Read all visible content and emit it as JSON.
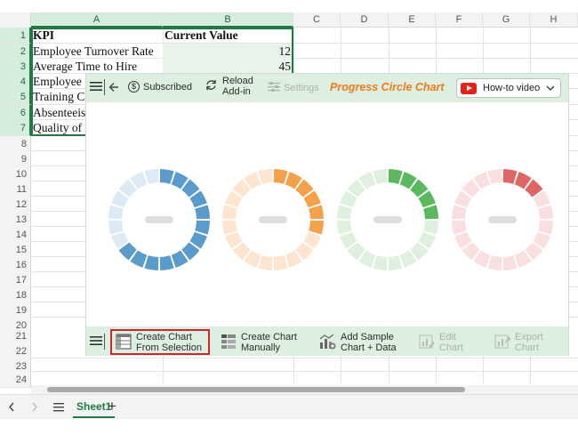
{
  "spreadsheet": {
    "columns": [
      "A",
      "B",
      "C",
      "D",
      "E",
      "F",
      "G",
      "H"
    ],
    "rows": [
      "1",
      "2",
      "3",
      "4",
      "5",
      "6",
      "7",
      "8",
      "9",
      "10",
      "11",
      "12",
      "13",
      "14",
      "15",
      "16",
      "17",
      "18",
      "19",
      "20",
      "21",
      "22",
      "23",
      "24"
    ],
    "headers": {
      "a": "KPI",
      "b": "Current Value"
    },
    "data": [
      {
        "kpi": "Employee Turnover Rate",
        "value": "12"
      },
      {
        "kpi": "Average Time to Hire",
        "value": "45"
      },
      {
        "kpi": "Employee S",
        "value": ""
      },
      {
        "kpi": "Training Co",
        "value": ""
      },
      {
        "kpi": "Absenteeis",
        "value": ""
      },
      {
        "kpi": "Quality of ",
        "value": ""
      }
    ]
  },
  "addin": {
    "toolbar": {
      "subscribed_label": "Subscribed",
      "reload_line1": "Reload",
      "reload_line2": "Add-in",
      "settings_label": "Settings",
      "brand": "Progress Circle Chart",
      "howto_label": "How-to video"
    },
    "progress_rings": [
      {
        "color": "#5b9bcc",
        "light": "#dde9f4",
        "filled": 13,
        "start": 0
      },
      {
        "color": "#f5a04a",
        "light": "#fde5cf",
        "filled": 6,
        "start": 0
      },
      {
        "color": "#5cb85c",
        "light": "#dff0df",
        "filled": 5,
        "start": 0
      },
      {
        "color": "#e06666",
        "light": "#f9dfe0",
        "filled": 3,
        "start": 0
      }
    ],
    "bottom_toolbar": {
      "create_selection_line1": "Create Chart",
      "create_selection_line2": "From Selection",
      "create_manual_line1": "Create Chart",
      "create_manual_line2": "Manually",
      "add_sample_line1": "Add Sample",
      "add_sample_line2": "Chart + Data",
      "edit_line1": "Edit",
      "edit_line2": "Chart",
      "export_line1": "Export",
      "export_line2": "Chart"
    }
  },
  "sheet_tabs": {
    "active": "Sheet1",
    "add": "+"
  }
}
